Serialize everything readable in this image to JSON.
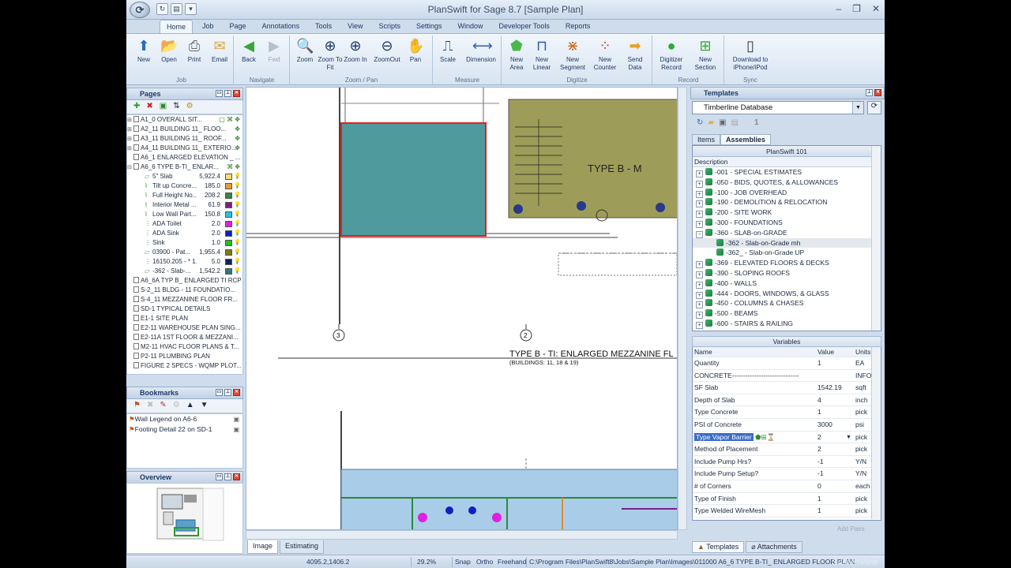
{
  "window": {
    "title": "PlanSwift for Sage 8.7   [Sample Plan]",
    "minimize": "–",
    "restore": "❐",
    "close": "✕"
  },
  "qat": [
    "↻",
    "▤",
    "▾"
  ],
  "ribbon_tabs": [
    "Home",
    "Job",
    "Page",
    "Annotations",
    "Tools",
    "View",
    "Scripts",
    "Settings",
    "Window",
    "Developer Tools",
    "Reports"
  ],
  "ribbon": {
    "groups": [
      {
        "label": "Job",
        "buttons": [
          {
            "label": "New"
          },
          {
            "label": "Open"
          },
          {
            "label": "Print"
          },
          {
            "label": "Email"
          }
        ]
      },
      {
        "label": "Navigate",
        "buttons": [
          {
            "label": "Back"
          },
          {
            "label": "Fwd"
          }
        ]
      },
      {
        "label": "Zoom / Pan",
        "buttons": [
          {
            "label": "Zoom"
          },
          {
            "label": "Zoom To Fit"
          },
          {
            "label": "Zoom In"
          },
          {
            "label": "ZoomOut"
          },
          {
            "label": "Pan"
          }
        ]
      },
      {
        "label": "Measure",
        "buttons": [
          {
            "label": "Scale"
          },
          {
            "label": "Dimension"
          }
        ]
      },
      {
        "label": "Digitize",
        "buttons": [
          {
            "label": "New Area"
          },
          {
            "label": "New Linear"
          },
          {
            "label": "New Segment"
          },
          {
            "label": "New Counter"
          },
          {
            "label": "Send Data"
          }
        ]
      },
      {
        "label": "Record",
        "buttons": [
          {
            "label": "Digitizer Record"
          },
          {
            "label": "New Section"
          }
        ]
      },
      {
        "label": "Sync",
        "buttons": [
          {
            "label": "Download to iPhone/iPod"
          }
        ]
      }
    ]
  },
  "pages_panel": {
    "title": "Pages",
    "items": [
      {
        "exp": "⊞",
        "label": "A1_0 OVERALL SIT...",
        "right": "▢ ⌘ ✥"
      },
      {
        "exp": "⊞",
        "label": "A2_11 BUILDING 11_ FLOO...",
        "right": "✥"
      },
      {
        "exp": "⊞",
        "label": "A3_11 BUILDING 11_ ROOF...",
        "right": "✥"
      },
      {
        "exp": "⊞",
        "label": "A4_11 BUILDING 11_ EXTERIO...",
        "right": "✥"
      },
      {
        "exp": "",
        "label": "A6_1 ENLARGED ELEVATION _ ...",
        "right": ""
      },
      {
        "exp": "⊟",
        "label": "A6_6 TYPE B-TI_ ENLAR...",
        "right": "⌘ ✥"
      }
    ],
    "takeoffs": [
      {
        "icon": "▱",
        "name": "5\" Slab",
        "value": "5,922.4",
        "color": "#f2df79"
      },
      {
        "icon": "⌇",
        "name": "Tilt up Concre...",
        "value": "185.0",
        "color": "#e69a3a"
      },
      {
        "icon": "⌇",
        "name": "Full Height No...",
        "value": "208.2",
        "color": "#2e8a3c"
      },
      {
        "icon": "⌇",
        "name": "Interior Metal ...",
        "value": "61.9",
        "color": "#7a1f8a"
      },
      {
        "icon": "⌇",
        "name": "Low Wall Part...",
        "value": "150.8",
        "color": "#2bbde0"
      },
      {
        "icon": "⋮",
        "name": "ADA Toilet",
        "value": "2.0",
        "color": "#e020e0"
      },
      {
        "icon": "⋮",
        "name": "ADA Sink",
        "value": "2.0",
        "color": "#1020c0"
      },
      {
        "icon": "⋮",
        "name": "Sink",
        "value": "1.0",
        "color": "#20c020"
      },
      {
        "icon": "▱",
        "name": "03900 - Pat...",
        "value": "1,955.4",
        "color": "#7a7a1a"
      },
      {
        "icon": "⋮",
        "name": "16150.205 - * 1...",
        "value": "5.0",
        "color": "#102060"
      },
      {
        "icon": "▱",
        "name": "-362 - Slab-...",
        "value": "1,542.2",
        "color": "#2a7a7a"
      }
    ],
    "items_after": [
      "A6_6A TYP B_ ENLARGED TI RCP",
      "S-2_11 BLDG - 11 FOUNDATIO...",
      "S-4_11 MEZZANINE FLOOR FR...",
      "SD-1 TYPICAL DETAILS",
      "E1-1 SITE PLAN",
      "E2-11 WAREHOUSE PLAN SING...",
      "E2-11A 1ST FLOOR & MEZZANI...",
      "M2-11 HVAC FLOOR PLANS & T...",
      "P2-11 PLUMBING PLAN",
      "FIGURE 2 SPECS - WQMP PLOT..."
    ]
  },
  "bookmarks_panel": {
    "title": "Bookmarks",
    "items": [
      "Wall Legend on A6-6",
      "Footing Detail 22 on SD-1"
    ]
  },
  "overview_panel": {
    "title": "Overview"
  },
  "drawing": {
    "area_label": "TYPE B - M",
    "grid_3": "3",
    "grid_2": "2",
    "plan_title": "TYPE B - TI: ENLARGED MEZZANINE FL",
    "plan_subtitle": "(BUILDINGS: 11, 18 & 19)"
  },
  "view_tabs": [
    "Image",
    "Estimating"
  ],
  "templates_panel": {
    "title": "Templates",
    "database": "Timberline Database",
    "tool_number": "1",
    "tabs": [
      "Items",
      "Assemblies"
    ],
    "assemblies_title": "PlanSwift 101",
    "column": "Description",
    "rows": [
      {
        "exp": "+",
        "label": "-001 - SPECIAL ESTIMATES"
      },
      {
        "exp": "+",
        "label": "-050 - BIDS, QUOTES, & ALLOWANCES"
      },
      {
        "exp": "+",
        "label": "-100 - JOB OVERHEAD"
      },
      {
        "exp": "+",
        "label": "-190 - DEMOLITION & RELOCATION"
      },
      {
        "exp": "+",
        "label": "-200 - SITE WORK"
      },
      {
        "exp": "+",
        "label": "-300 - FOUNDATIONS"
      },
      {
        "exp": "−",
        "label": "-360 - SLAB-on-GRADE"
      },
      {
        "exp": "",
        "label": "-362 - Slab-on-Grade mh",
        "child": true,
        "selected": true
      },
      {
        "exp": "",
        "label": "-362_ - Slab-on-Grade UP",
        "child": true
      },
      {
        "exp": "+",
        "label": "-369 - ELEVATED FLOORS & DECKS"
      },
      {
        "exp": "+",
        "label": "-390 - SLOPING ROOFS"
      },
      {
        "exp": "+",
        "label": "-400 - WALLS"
      },
      {
        "exp": "+",
        "label": "-444 - DOORS, WINDOWS, & GLASS"
      },
      {
        "exp": "+",
        "label": "-450 - COLUMNS & CHASES"
      },
      {
        "exp": "+",
        "label": "-500 - BEAMS"
      },
      {
        "exp": "+",
        "label": "-600 - STAIRS & RAILING"
      }
    ]
  },
  "variables_panel": {
    "title": "Variables",
    "columns": {
      "name": "Name",
      "value": "Value",
      "units": "Units"
    },
    "rows": [
      {
        "name": "Quantity",
        "value": "1",
        "units": "EA"
      },
      {
        "name": "CONCRETE------------------------------",
        "value": "",
        "units": "INFO"
      },
      {
        "name": "SF Slab",
        "value": "1542.19",
        "units": "sqft"
      },
      {
        "name": "Depth of Slab",
        "value": "4",
        "units": "inch"
      },
      {
        "name": "Type Concrete",
        "value": "1",
        "units": "pick"
      },
      {
        "name": "PSI of Concrete",
        "value": "3000",
        "units": "psi"
      },
      {
        "name": "Type Vapor Barrier",
        "value": "2",
        "units": "pick",
        "selected": true
      },
      {
        "name": "Method of Placement",
        "value": "2",
        "units": "pick"
      },
      {
        "name": "Include Pump Hrs?",
        "value": "-1",
        "units": "Y/N"
      },
      {
        "name": "Include Pump Setup?",
        "value": "-1",
        "units": "Y/N"
      },
      {
        "name": "# of Corners",
        "value": "0",
        "units": "each"
      },
      {
        "name": "Type of Finish",
        "value": "1",
        "units": "pick"
      },
      {
        "name": "Type Welded WireMesh",
        "value": "1",
        "units": "pick"
      }
    ],
    "add_pairs": "Add Pairs"
  },
  "right_tabs": [
    "Templates",
    "Attachments"
  ],
  "status": {
    "coords": "4095.2,1406.2",
    "zoom": "29.2%",
    "snap": "Snap",
    "ortho": "Ortho",
    "freehand": "Freehand",
    "path": "C:\\Program Files\\PlanSwift8\\Jobs\\Sample Plan\\Images\\011000 A6_6 TYPE B-TI_ ENLARGED FLOOR PLAN.",
    "watermark": "ScreenView"
  }
}
